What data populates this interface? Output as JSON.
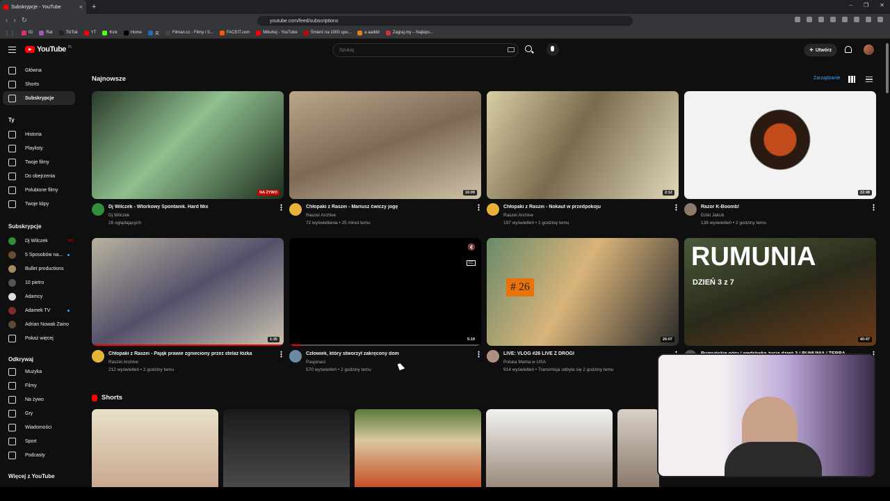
{
  "browser": {
    "tab_title": "Subskrypcje - YouTube",
    "url": "youtube.com/feed/subscriptions",
    "bookmarks": [
      "IG",
      "Rat",
      "TikTok",
      "YT",
      "Kick",
      "Home",
      "天",
      "Filman.cc - Filmy i S...",
      "FACEIT.com",
      "Mikuhej - YouTube",
      "Śmierć na 1000 spo...",
      "a aaddd",
      "Zagraj.my – Najleps..."
    ],
    "bookmark_colors": [
      "#e1306c",
      "#9b59b6",
      "#222222",
      "#ff0000",
      "#53fc18",
      "#000000",
      "#1d6fb8",
      "#444444",
      "#ff5500",
      "#ff0000",
      "#cc0000",
      "#e67e22",
      "#cc3333"
    ]
  },
  "youtube": {
    "logo_text": "YouTube",
    "logo_country": "PL",
    "search_placeholder": "Szukaj",
    "create_label": "Utwórz"
  },
  "sidebar": {
    "items": [
      {
        "label": "Główna",
        "icon": "home-icon"
      },
      {
        "label": "Shorts",
        "icon": "shorts-icon"
      },
      {
        "label": "Subskrypcje",
        "icon": "subscriptions-icon",
        "active": true
      }
    ],
    "you_header": "Ty",
    "you_items": [
      {
        "label": "Historia",
        "icon": "history-icon"
      },
      {
        "label": "Playlisty",
        "icon": "playlist-icon"
      },
      {
        "label": "Twoje filmy",
        "icon": "video-icon"
      },
      {
        "label": "Do obejrzenia",
        "icon": "clock-icon"
      },
      {
        "label": "Polubione filmy",
        "icon": "like-icon"
      },
      {
        "label": "Twoje klipy",
        "icon": "scissors-icon"
      }
    ],
    "subs_header": "Subskrypcje",
    "subs": [
      {
        "label": "Dj Wilczek",
        "live": true,
        "color": "#2f8f3a"
      },
      {
        "label": "5 Sposobów na...",
        "dot": true,
        "color": "#6b4a2f"
      },
      {
        "label": "Bullet productions",
        "color": "#a38c5a"
      },
      {
        "label": "10 pietro",
        "color": "#555555"
      },
      {
        "label": "Adamcy",
        "color": "#dddddd"
      },
      {
        "label": "Adamek TV",
        "dot": true,
        "color": "#7a2d2d"
      },
      {
        "label": "Adrian Nowak Zaino",
        "color": "#5a4a3a"
      }
    ],
    "show_more": "Pokaż więcej",
    "explore_header": "Odkrywaj",
    "explore_items": [
      {
        "label": "Muzyka",
        "icon": "music-icon"
      },
      {
        "label": "Filmy",
        "icon": "film-icon"
      },
      {
        "label": "Na żywo",
        "icon": "live-icon"
      },
      {
        "label": "Gry",
        "icon": "gamepad-icon"
      },
      {
        "label": "Wiadomości",
        "icon": "news-icon"
      },
      {
        "label": "Sport",
        "icon": "trophy-icon"
      },
      {
        "label": "Podcasty",
        "icon": "podcast-icon"
      }
    ],
    "more_header": "Więcej z YouTube"
  },
  "main": {
    "section_title": "Najnowsze",
    "manage_label": "Zarządzanie",
    "videos": [
      {
        "title": "Dj Wilczek - Wtorkowy Spontanik. Hard Mix",
        "channel": "Dj Wilczek",
        "meta": "26 oglądających",
        "badge": "NA ŻYWO",
        "live": true,
        "thumb": "linear-gradient(135deg,#2a3a2a,#8fbf8f 45%,#1e2e1e)",
        "avatar": "#2f8f3a"
      },
      {
        "title": "Chłopaki z Raszei - Mariusz ćwiczy jogę",
        "channel": "Raszei Archive",
        "meta": "72 wyświetlenia • 25 minut temu",
        "badge": "16:09",
        "thumb": "linear-gradient(160deg,#b9a68a,#7d6a55 50%,#cfc2a8)",
        "avatar": "#e7b23a"
      },
      {
        "title": "Chłopaki z Raszei - Nokaut w przedpokoju",
        "channel": "Raszei Archive",
        "meta": "197 wyświetleń • 1 godzinę temu",
        "badge": "2:12",
        "thumb": "linear-gradient(120deg,#d8cfa5,#7a6a4e 45%,#e0d8b9)",
        "avatar": "#e7b23a"
      },
      {
        "title": "Razor K-Boomb!",
        "channel": "Dziki Jakub",
        "meta": "138 wyświetleń • 2 godziny temu",
        "badge": "22:48",
        "thumb": "radial-gradient(circle at 50% 45%,#c34a1a 0 14%,#2a1a12 15% 26%,#f2f2f2 27%)",
        "avatar": "#8a7a6a"
      },
      {
        "title": "Chłopaki z Raszei - Pająk prawie zgnieciony przez stelaż łóżka",
        "channel": "Raszei Archive",
        "meta": "212 wyświetleń • 2 godziny temu",
        "badge": "1:35",
        "progress": 100,
        "thumb": "linear-gradient(150deg,#b8b2a0,#55506a 50%,#c9c3b0)",
        "avatar": "#e7b23a"
      },
      {
        "title": "Człowiek, który stworzył zakręcony dom",
        "channel": "Pasjonaci",
        "meta": "570 wyświetleń • 2 godziny temu",
        "badge": "5:19",
        "thumb": "#000000",
        "avatar": "#6a8aa8"
      },
      {
        "title": "LIVE: VLOG #26 LIVE Z DROGI",
        "channel": "Polska Mama w USA",
        "meta": "914 wyświetleń • Transmisja odbyła się 2 godziny temu",
        "badge": "26:07",
        "overlay": "# 26",
        "thumb": "linear-gradient(120deg,#6a8a6a,#d9b47a 45%,#2a2a2a)",
        "avatar": "#b09080"
      },
      {
        "title": "Rumuńskie góry / wędrówka życia dzień 3 / RUMUNIA / TERRA",
        "channel": "",
        "meta": "",
        "badge": "40:47",
        "overlay": "RUMUNIA",
        "overlay2": "DZIEŃ 3 z 7",
        "thumb": "linear-gradient(160deg,#4a5a3a,#2a2a1a 50%,#6a3a1a)",
        "avatar": "#555555"
      }
    ],
    "shorts_title": "Shorts",
    "shorts": [
      {
        "thumb": "linear-gradient(180deg,#e8e0c8,#caa890)"
      },
      {
        "thumb": "linear-gradient(180deg,#1a1a1a,#4a4a4a)"
      },
      {
        "thumb": "linear-gradient(180deg,#5a7a3a,#d8c8a0 40%,#c8502a)"
      },
      {
        "thumb": "linear-gradient(180deg,#f2f2f2,#9a8a7a)"
      },
      {
        "thumb": "linear-gradient(180deg,#d8d0c8,#8a7a6a)"
      }
    ]
  },
  "player": {
    "mute_icon": "mute-icon",
    "cc_label": "CC"
  }
}
